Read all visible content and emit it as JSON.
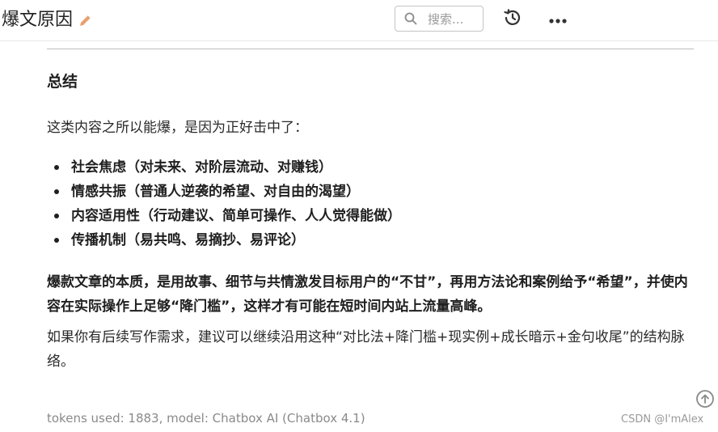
{
  "header": {
    "title": "爆文原因",
    "search_placeholder": "搜索..."
  },
  "icons": {
    "edit": "pencil-icon",
    "search": "search-icon",
    "history": "history-icon",
    "more": "more-horizontal-icon",
    "scroll_top": "arrow-up-circle-icon"
  },
  "colors": {
    "pencil": "#e8a070",
    "icon_dark": "#333333",
    "muted": "#8a8a8a"
  },
  "content": {
    "section_title": "总结",
    "intro": "这类内容之所以能爆，是因为正好击中了：",
    "bullets": [
      "社会焦虑（对未来、对阶层流动、对赚钱）",
      "情感共振（普通人逆袭的希望、对自由的渴望）",
      "内容适用性（行动建议、简单可操作、人人觉得能做）",
      "传播机制（易共鸣、易摘抄、易评论）"
    ],
    "para_bold": "爆款文章的本质，是用故事、细节与共情激发目标用户的“不甘”，再用方法论和案例给予“希望”，并使内容在实际操作上足够“降门槛”，这样才有可能在短时间内站上流量高峰。",
    "para": "如果你有后续写作需求，建议可以继续沿用这种“对比法+降门槛+现实例+成长暗示+金句收尾”的结构脉络。"
  },
  "footer": {
    "meta": "tokens used: 1883, model: Chatbox AI (Chatbox 4.1)",
    "watermark": "CSDN @I'mAlex"
  }
}
